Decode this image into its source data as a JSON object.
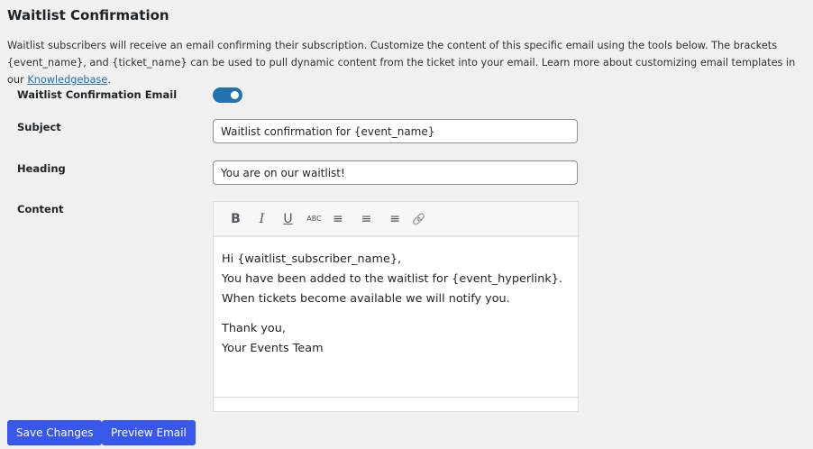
{
  "title": "Waitlist Confirmation",
  "description": "Waitlist subscribers will receive an email confirming their subscription. Customize the content of this specific email using the tools below. The brackets {event_name}, and {ticket_name} can be used to pull dynamic content from the ticket into your email. Learn more about customizing email templates in our ",
  "kb_link": "Knowledgebase",
  "desc_end": ".",
  "fields": {
    "toggle_label": "Waitlist Confirmation Email",
    "toggle_on": true,
    "subject_label": "Subject",
    "subject_value": "Waitlist confirmation for {event_name}",
    "heading_label": "Heading",
    "heading_value": "You are on our waitlist!",
    "content_label": "Content"
  },
  "toolbar": {
    "bold": "B",
    "italic": "I",
    "underline": "U",
    "strike": "ABC",
    "align_left": "≡",
    "align_center": "≡",
    "align_right": "≡",
    "link": "🔗"
  },
  "content": {
    "line1": "Hi {waitlist_subscriber_name},",
    "line2": "You have been added to the waitlist for {event_hyperlink}.",
    "line3": "When tickets become available we will notify you.",
    "line4": "Thank you,",
    "line5": "Your Events Team"
  },
  "buttons": {
    "save": "Save Changes",
    "preview": "Preview Email"
  }
}
